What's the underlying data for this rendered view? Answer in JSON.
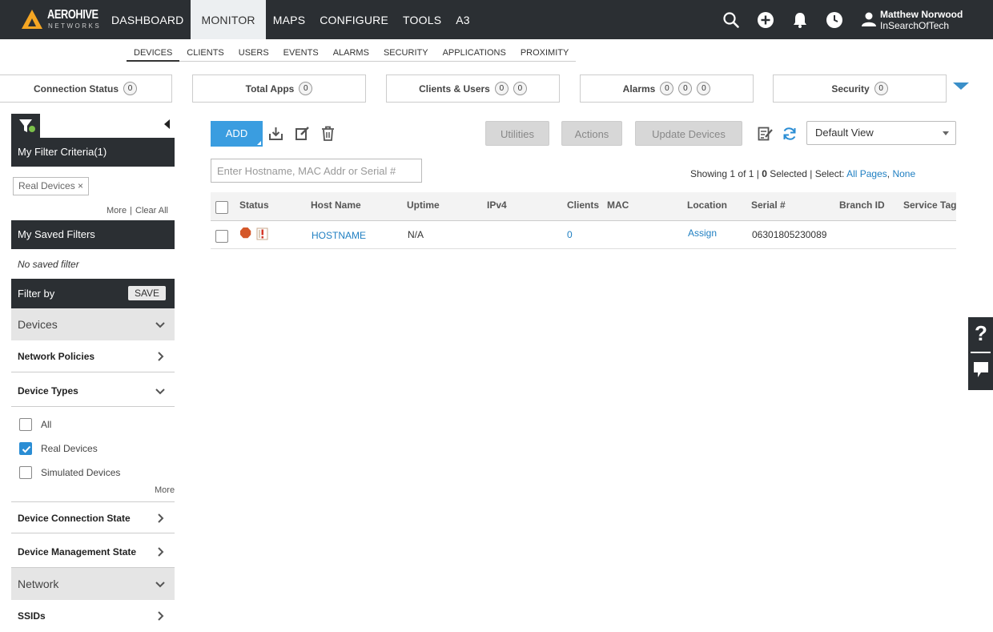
{
  "brand": {
    "name": "AEROHIVE",
    "sub": "NETWORKS"
  },
  "topnav": [
    {
      "label": "DASHBOARD",
      "active": false
    },
    {
      "label": "MONITOR",
      "active": true
    },
    {
      "label": "MAPS",
      "active": false
    },
    {
      "label": "CONFIGURE",
      "active": false
    },
    {
      "label": "TOOLS",
      "active": false
    },
    {
      "label": "A3",
      "active": false
    }
  ],
  "user": {
    "name": "Matthew Norwood",
    "org": "InSearchOfTech"
  },
  "subnav": [
    {
      "label": "DEVICES",
      "active": true
    },
    {
      "label": "CLIENTS",
      "active": false
    },
    {
      "label": "USERS",
      "active": false
    },
    {
      "label": "EVENTS",
      "active": false
    },
    {
      "label": "ALARMS",
      "active": false
    },
    {
      "label": "SECURITY",
      "active": false
    },
    {
      "label": "APPLICATIONS",
      "active": false
    },
    {
      "label": "PROXIMITY",
      "active": false
    }
  ],
  "widgets": [
    {
      "label": "Connection Status",
      "counts": [
        "0"
      ]
    },
    {
      "label": "Total Apps",
      "counts": [
        "0"
      ]
    },
    {
      "label": "Clients & Users",
      "counts": [
        "0",
        "0"
      ]
    },
    {
      "label": "Alarms",
      "counts": [
        "0",
        "0",
        "0"
      ]
    },
    {
      "label": "Security",
      "counts": [
        "0"
      ]
    }
  ],
  "filters": {
    "criteria_title": "My Filter Criteria(1)",
    "chip": "Real Devices ×",
    "more": "More",
    "clear_all": "Clear All",
    "saved_title": "My Saved Filters",
    "no_saved": "No saved filter",
    "filter_by": "Filter by",
    "save": "SAVE",
    "devices": "Devices",
    "network_policies": "Network Policies",
    "device_types": "Device Types",
    "type_options": [
      {
        "label": "All",
        "checked": false
      },
      {
        "label": "Real Devices",
        "checked": true
      },
      {
        "label": "Simulated Devices",
        "checked": false
      }
    ],
    "types_more": "More",
    "device_connection_state": "Device Connection State",
    "device_management_state": "Device Management State",
    "network": "Network",
    "ssids": "SSIDs"
  },
  "toolbar": {
    "add": "ADD",
    "utilities": "Utilities",
    "actions": "Actions",
    "update_devices": "Update Devices",
    "view": "Default View",
    "search_placeholder": "Enter Hostname, MAC Addr or Serial #"
  },
  "showing": {
    "prefix": "Showing ",
    "range": "1",
    "of": " of 1 | ",
    "selected": "0",
    "sel_text": " Selected | Select: ",
    "all_pages": "All Pages",
    "sep": ", ",
    "none": "None"
  },
  "table": {
    "headers": [
      "Status",
      "Host Name",
      "Uptime",
      "IPv4",
      "Clients",
      "MAC",
      "Location",
      "Serial #",
      "Branch ID",
      "Service Tag"
    ],
    "rows": [
      {
        "host": "HOSTNAME",
        "uptime": "N/A",
        "ipv4": "",
        "clients": "0",
        "mac": "",
        "location": "Assign",
        "serial": "06301805230089",
        "branch": "",
        "service": ""
      }
    ]
  },
  "colors": {
    "nav_bg": "#2b2f33",
    "accent": "#3a9de0",
    "link": "#1f7fc2",
    "status_hex": "#d4582a",
    "brand_yellow": "#f5a623"
  }
}
